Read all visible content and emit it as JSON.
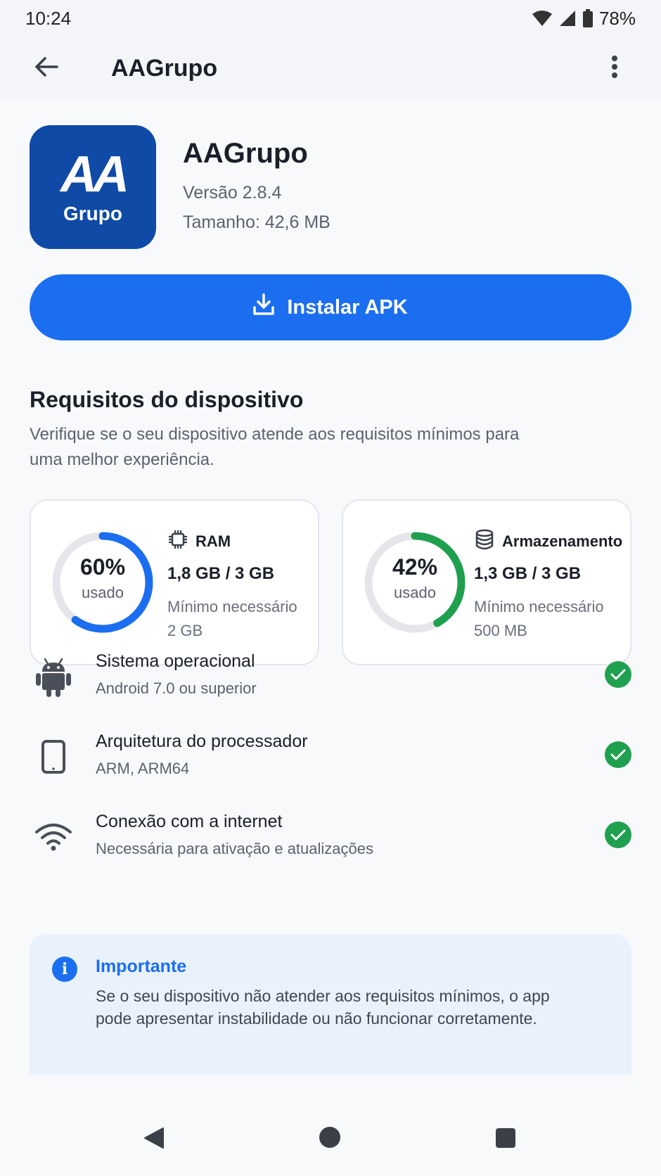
{
  "status_bar": {
    "time": "10:24",
    "battery": "78%",
    "icons": [
      "wifi-icon",
      "signal-icon",
      "battery-icon"
    ]
  },
  "app_bar": {
    "title": "AAGrupo",
    "back_icon": "arrow-back-icon",
    "menu_icon": "more-vert-icon"
  },
  "app": {
    "logo_letters": "AA",
    "logo_word": "Grupo",
    "name": "AAGrupo",
    "version": "Versão 2.8.4",
    "size": "Tamanho: 42,6 MB"
  },
  "install_button": {
    "label": "Instalar APK",
    "icon": "download-icon",
    "color": "#1b6ef0"
  },
  "requirements": {
    "title": "Requisitos do dispositivo",
    "description": "Verifique se o seu dispositivo atende aos requisitos mínimos para uma melhor experiência.",
    "ram": {
      "percent": 60,
      "percent_label": "60%",
      "used_label": "usado",
      "label": "RAM",
      "value": "1,8 GB / 3 GB",
      "min_label": "Mínimo necessário",
      "min_value": "2 GB",
      "color": "#1b6ef0"
    },
    "storage": {
      "percent": 42,
      "percent_label": "42%",
      "used_label": "usado",
      "label": "Armazenamento",
      "value": "1,3 GB / 3 GB",
      "min_label": "Mínimo necessário",
      "min_value": "500 MB",
      "color": "#1fa04f"
    },
    "items": [
      {
        "title": "Sistema operacional",
        "subtitle": "Android 7.0 ou superior",
        "icon": "android-icon",
        "status": "ok"
      },
      {
        "title": "Arquitetura do processador",
        "subtitle": "ARM, ARM64",
        "icon": "phone-icon",
        "status": "ok"
      },
      {
        "title": "Conexão com a internet",
        "subtitle": "Necessária para ativação e atualizações",
        "icon": "wifi-icon",
        "status": "ok"
      }
    ]
  },
  "notice": {
    "title": "Importante",
    "text": "Se o seu dispositivo não atender aos requisitos mínimos, o app pode apresentar instabilidade ou não funcionar corretamente.",
    "icon": "info-icon"
  },
  "nav_bar": {
    "icons": [
      "nav-back-icon",
      "nav-home-icon",
      "nav-recents-icon"
    ]
  }
}
